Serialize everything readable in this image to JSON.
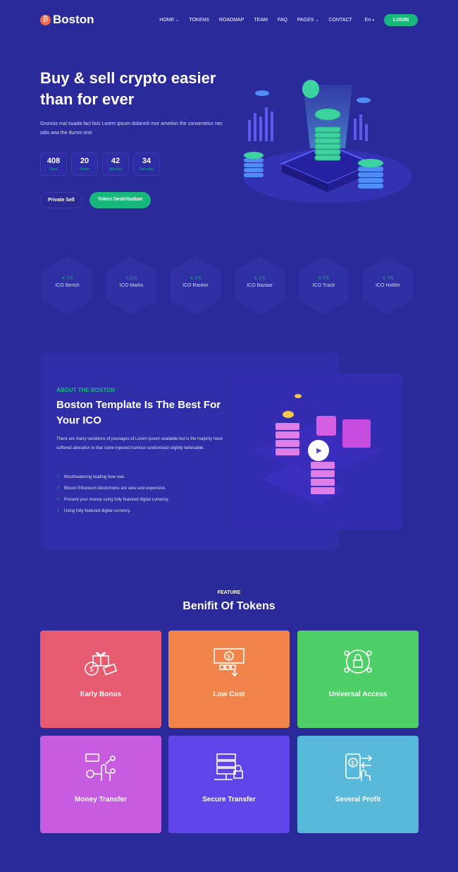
{
  "brand": {
    "name": "Boston"
  },
  "nav": {
    "items": [
      "HOME",
      "TOKENS",
      "ROADMAP",
      "TEAM",
      "FAQ",
      "PAGES",
      "CONTACT"
    ],
    "language": "En",
    "login": "LOGIN"
  },
  "hero": {
    "title": "Buy & sell crypto easier than for ever",
    "description": "Grursus mal suada faci lisis Lorem ipsum dolarorit mor ametion the consectetur nec odio aea the dumm text.",
    "countdown": [
      {
        "value": "408",
        "label": "Days"
      },
      {
        "value": "20",
        "label": "Hours"
      },
      {
        "value": "42",
        "label": "Minutes"
      },
      {
        "value": "34",
        "label": "Seconds"
      }
    ],
    "btn_private": "Private Sell",
    "btn_token": "Token Destribution"
  },
  "ratings": [
    {
      "score": "4.7/5",
      "name": "ICO Bench"
    },
    {
      "score": "0.5/5",
      "name": "ICO Marks"
    },
    {
      "score": "4.7/5",
      "name": "ICO Ranker"
    },
    {
      "score": "4.7/5",
      "name": "ICO Bazaar"
    },
    {
      "score": "4.7/5",
      "name": "ICO Track"
    },
    {
      "score": "4.7/5",
      "name": "ICO Holder"
    }
  ],
  "about": {
    "kicker": "ABOUT THE BOSTON",
    "title": "Boston Template Is The Best For Your ICO",
    "description": "There are many variations of passages of Lorem Ipsum available but is the majority have suffered alteration in that some injected humour randomised slightly believable.",
    "list": [
      "Mouthwatering leading how real.",
      "Bitcoin Ethereum blockchoins are slow and expensive.",
      "Present your money using fully featured digital currency.",
      "Using fully featured digital currency."
    ]
  },
  "features": {
    "kicker": "FEATURE",
    "title": "Benifit Of Tokens",
    "cards": [
      {
        "label": "Early Bonus",
        "icon": "gift-money-icon",
        "color": "#e75b71"
      },
      {
        "label": "Low Cost",
        "icon": "cash-icon",
        "color": "#f0844a"
      },
      {
        "label": "Universal Access",
        "icon": "lock-network-icon",
        "color": "#4ecf67"
      },
      {
        "label": "Money Transfer",
        "icon": "touch-transfer-icon",
        "color": "#c75ce0"
      },
      {
        "label": "Secure Transfer",
        "icon": "server-lock-icon",
        "color": "#6046ea"
      },
      {
        "label": "Several Profit",
        "icon": "phone-payment-icon",
        "color": "#57b8da"
      }
    ]
  },
  "colors": {
    "background": "#2b2a9b",
    "accent": "#18b87c"
  }
}
